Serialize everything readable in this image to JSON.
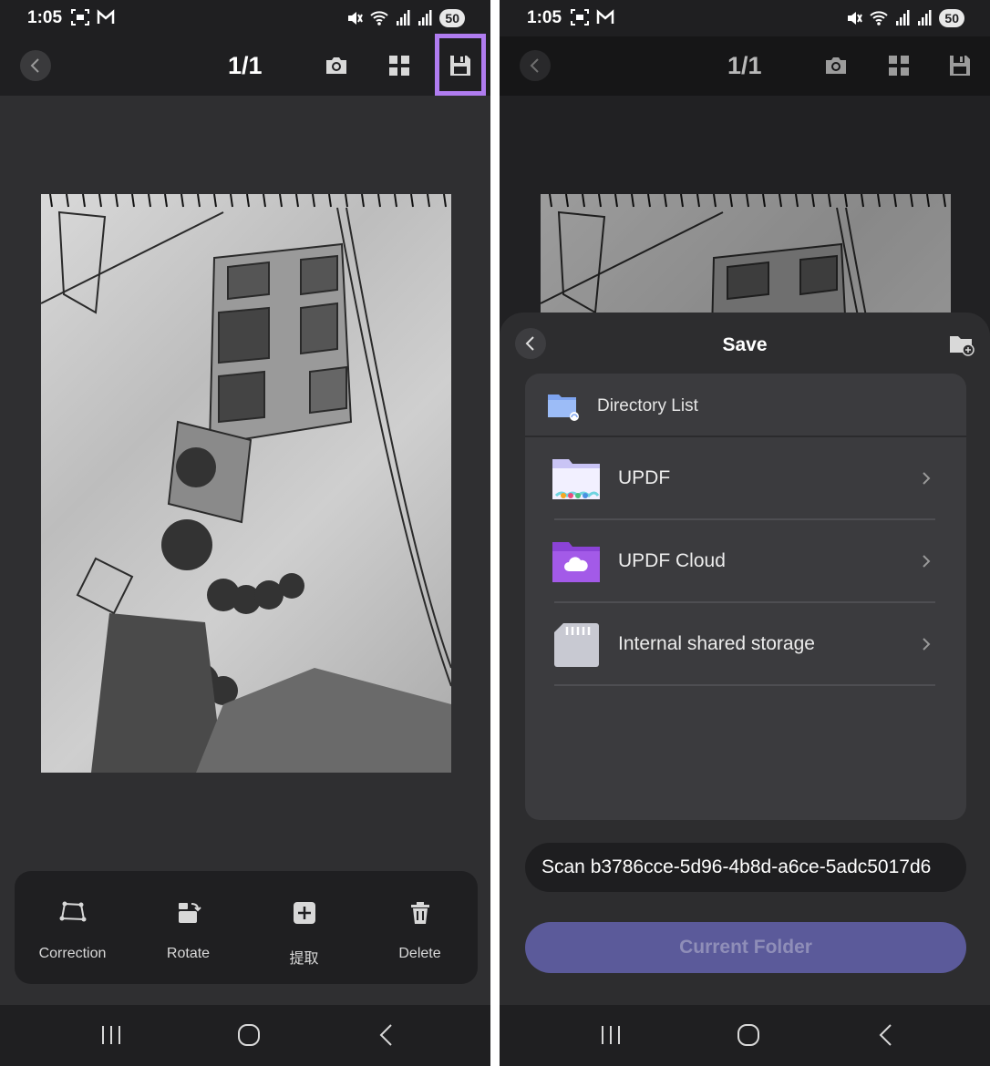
{
  "status": {
    "time": "1:05",
    "battery": "50"
  },
  "toolbar": {
    "page_counter": "1/1"
  },
  "actions": [
    {
      "label": "Correction"
    },
    {
      "label": "Rotate"
    },
    {
      "label": "提取"
    },
    {
      "label": "Delete"
    }
  ],
  "save_sheet": {
    "title": "Save",
    "directory_header": "Directory List",
    "rows": [
      {
        "label": "UPDF"
      },
      {
        "label": "UPDF Cloud"
      },
      {
        "label": "Internal shared storage"
      }
    ],
    "filename": "Scan b3786cce-5d96-4b8d-a6ce-5adc5017d6",
    "current_folder_button": "Current Folder"
  },
  "colors": {
    "highlight": "#b07cf0",
    "primary_button": "#5b5a9a",
    "updf_cloud_folder": "#a35ae8"
  }
}
